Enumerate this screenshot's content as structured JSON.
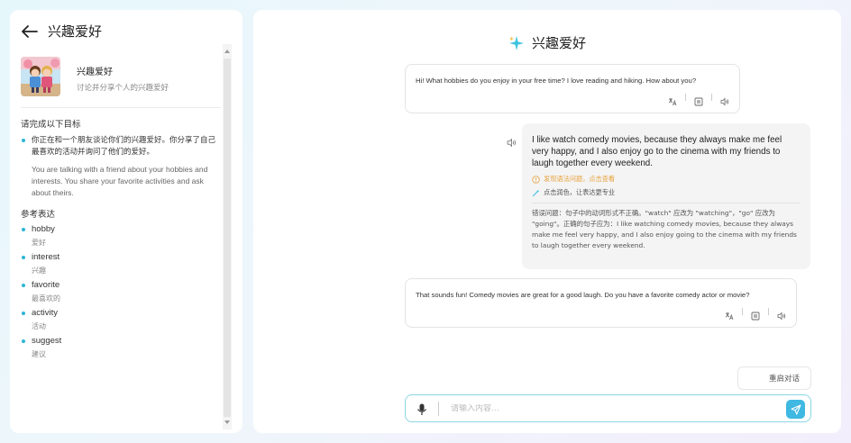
{
  "sidebar": {
    "title": "兴趣爱好",
    "topic": {
      "name": "兴趣爱好",
      "description": "讨论并分享个人的兴趣爱好"
    },
    "goal_heading": "请完成以下目标",
    "goal_cn": "你正在和一个朋友谈论你们的兴趣爱好。你分享了自己最喜欢的活动并询问了他们的爱好。",
    "goal_en": "You are talking with a friend about your hobbies and interests. You share your favorite activities and ask about theirs.",
    "ref_heading": "参考表达",
    "vocab": [
      {
        "word": "hobby",
        "meaning": "爱好"
      },
      {
        "word": "interest",
        "meaning": "兴趣"
      },
      {
        "word": "favorite",
        "meaning": "最喜欢的"
      },
      {
        "word": "activity",
        "meaning": "活动"
      },
      {
        "word": "suggest",
        "meaning": "建议"
      }
    ]
  },
  "chat": {
    "title": "兴趣爱好",
    "messages": [
      {
        "role": "ai",
        "text": "Hi! What hobbies do you enjoy in your free time? I love reading and hiking. How about you?"
      },
      {
        "role": "user",
        "text": "I like watch comedy movies, because they always make me feel very happy, and I also enjoy go to the cinema with my friends to laugh together every weekend.",
        "grammar_hint": "发现语法问题，点击查看",
        "polish_hint": "点击润色，让表达更专业",
        "correction": "错误问题：句子中的动词形式不正确。\"watch\" 应改为 \"watching\"，\"go\" 应改为 \"going\"。正确的句子应为：I like watching comedy movies, because they always make me feel very happy, and I also enjoy going to the cinema with my friends to laugh together every weekend."
      },
      {
        "role": "ai",
        "text": "That sounds fun! Comedy movies are great for a good laugh. Do you have a favorite comedy actor or movie?"
      }
    ],
    "restart_label": "重启对话",
    "input_placeholder": "请输入内容..."
  },
  "colors": {
    "accent": "#2cb5d8",
    "send_button": "#3fb8e2",
    "warning": "#e8a23c",
    "input_border": "#8bd6e6"
  },
  "icons": [
    "back-arrow-icon",
    "sparkle-icon",
    "translate-icon",
    "copy-icon",
    "speaker-icon",
    "warning-icon",
    "magic-wand-icon",
    "mic-icon",
    "send-icon"
  ]
}
